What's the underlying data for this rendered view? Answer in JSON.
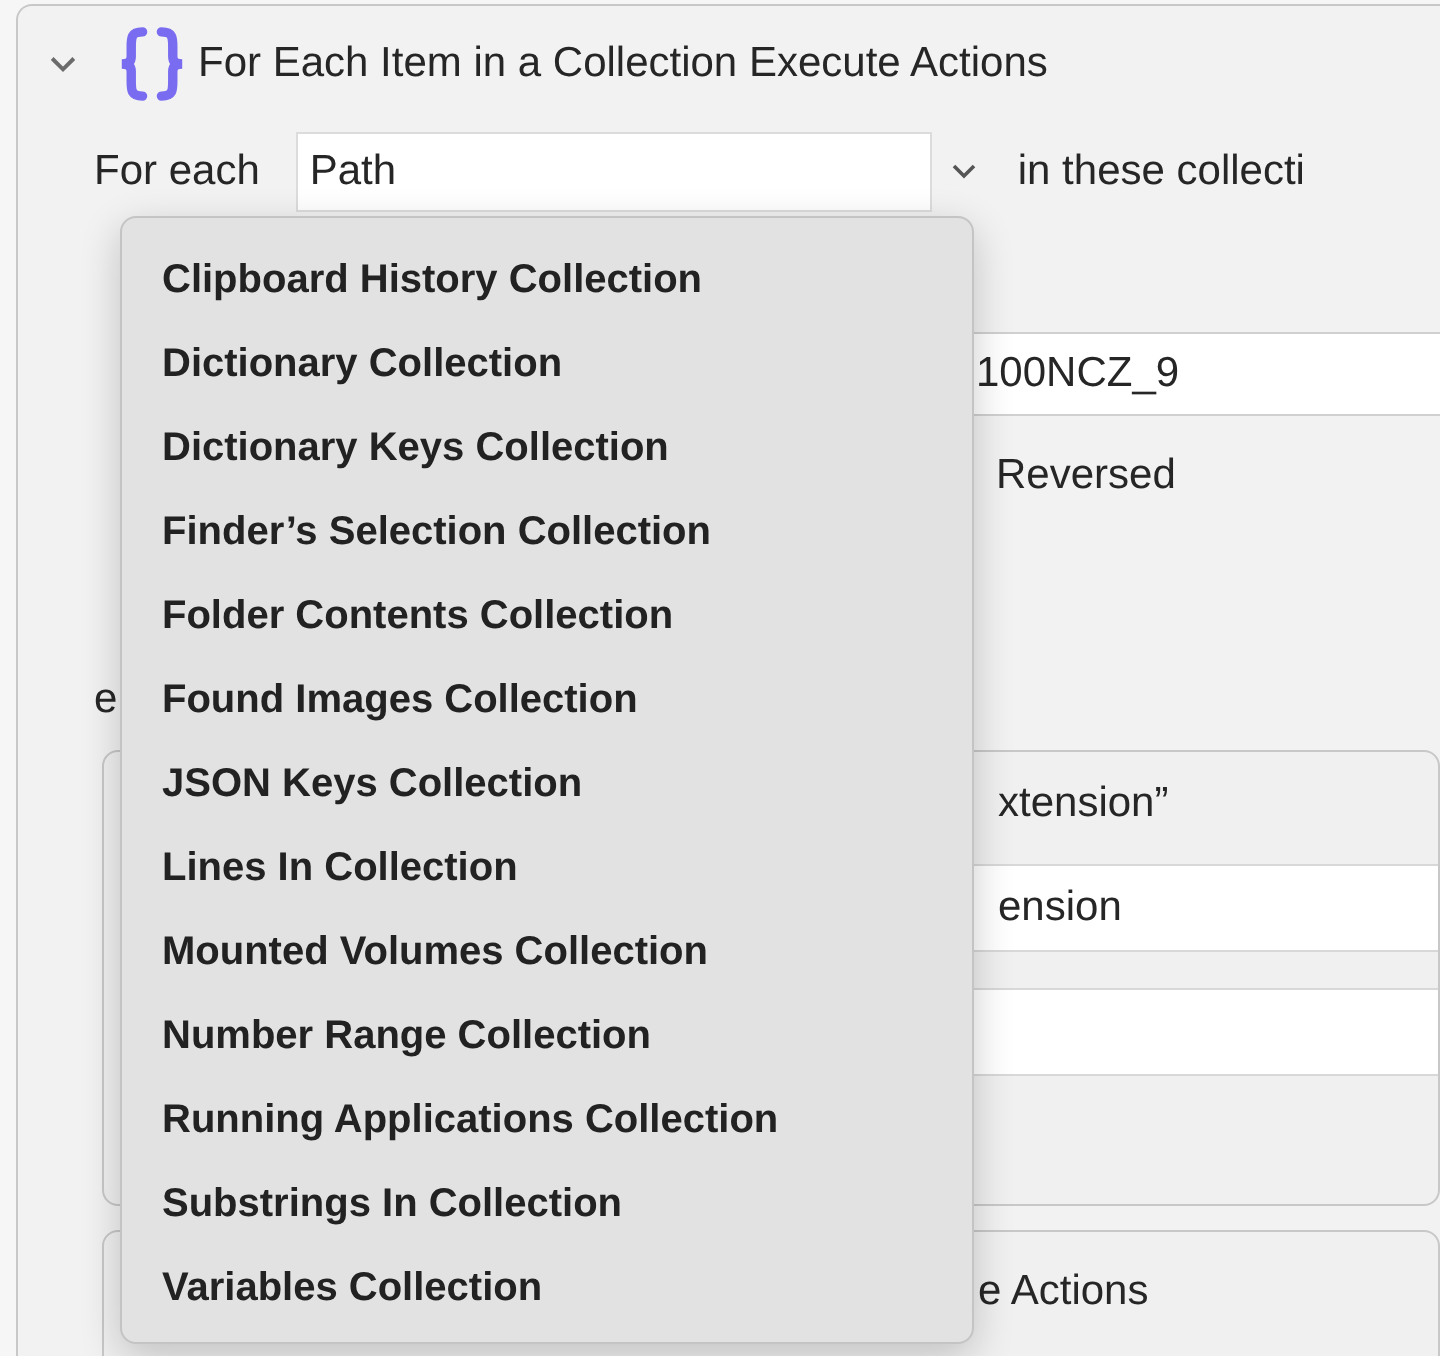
{
  "action": {
    "title": "For Each Item in a Collection Execute Actions",
    "expanded": true
  },
  "for_each": {
    "label": "For each",
    "variable": "Path",
    "suffix": "in these collecti"
  },
  "background": {
    "field_value": "100NCZ_9",
    "option_label": "Reversed",
    "label_fragment": "e",
    "group": {
      "label_fragment": "xtension”",
      "field_value": "ension"
    },
    "next_group": {
      "title_fragment": "e Actions"
    }
  },
  "menu": {
    "items": [
      {
        "label": "Clipboard History Collection"
      },
      {
        "label": "Dictionary Collection"
      },
      {
        "label": "Dictionary Keys Collection"
      },
      {
        "label": "Finder’s Selection Collection"
      },
      {
        "label": "Folder Contents Collection"
      },
      {
        "label": "Found Images Collection"
      },
      {
        "label": "JSON Keys Collection"
      },
      {
        "label": "Lines In Collection"
      },
      {
        "label": "Mounted Volumes Collection"
      },
      {
        "label": "Number Range Collection"
      },
      {
        "label": "Running Applications Collection"
      },
      {
        "label": "Substrings In Collection"
      },
      {
        "label": "Variables Collection"
      }
    ]
  }
}
